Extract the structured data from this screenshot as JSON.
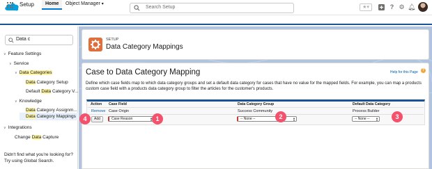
{
  "global_header": {
    "search_placeholder": "Search Setup",
    "icons": [
      "salesforce-logo",
      "search-icon",
      "favorites-icon",
      "add-icon",
      "help-icon",
      "settings-icon",
      "notifications-icon",
      "avatar"
    ]
  },
  "nav": {
    "app_name": "Setup",
    "tabs": [
      {
        "label": "Home",
        "active": true
      },
      {
        "label": "Object Manager",
        "active": false
      }
    ]
  },
  "sidebar": {
    "quick_find_value": "Data c",
    "tree": {
      "feature_settings": "Feature Settings",
      "service": "Service",
      "data_categories_pre": "",
      "data_categories_hl": "Data Categories",
      "data_category_setup_hl": "Data",
      "data_category_setup_rest": " Category Setup",
      "default_dcv_pre": "Default ",
      "default_dcv_hl": "Data",
      "default_dcv_rest": " Category V...",
      "knowledge": "Knowledge",
      "dca_hl": "Data",
      "dca_rest": " Category Assignm...",
      "dcm_hl": "Data",
      "dcm_rest": " Category Mappings",
      "integrations": "Integrations",
      "change_pre": "Change ",
      "change_hl": "Data",
      "change_rest": " Capture"
    },
    "footer_line1": "Didn't find what you're looking for?",
    "footer_line2": "Try using Global Search."
  },
  "setup_header": {
    "subtitle": "SETUP",
    "title": "Data Category Mappings"
  },
  "page": {
    "heading": "Case to Data Category Mapping",
    "help_link": "Help for this Page",
    "description": "Define which case fields map to which data category groups and set a default data category for cases that have no value for the mapped fields. For example, you can map a products custom case field with a products data category group to filter the articles for the customer's products."
  },
  "mapping_table": {
    "headers": [
      "Action",
      "Case Field",
      "Data Category Group",
      "Default Data Category"
    ],
    "rows": [
      {
        "action": "Remove",
        "case_field": "Case Origin",
        "group": "Success Community",
        "default_category": "Process Builder"
      }
    ],
    "add_button": "Add",
    "new_row": {
      "case_field_select": "Case Reason",
      "group_select": "-- None --",
      "default_select": "-- None --"
    }
  },
  "callouts": [
    "1",
    "2",
    "3",
    "4"
  ],
  "colors": {
    "brand_blue": "#1b5297",
    "setup_orange": "#e06f3b",
    "callout_pink": "#f4516c",
    "highlight_yellow": "#fff5a6",
    "link_blue": "#015ba7"
  }
}
